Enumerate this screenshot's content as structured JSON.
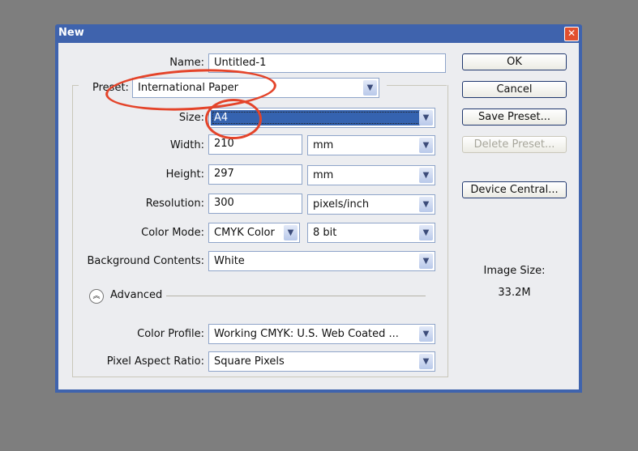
{
  "window": {
    "title": "New",
    "close_icon": "close-icon"
  },
  "fields": {
    "name": {
      "label": "Name:",
      "value": "Untitled-1"
    },
    "preset": {
      "label": "Preset:",
      "value": "International Paper"
    },
    "size": {
      "label": "Size:",
      "value": "A4"
    },
    "width": {
      "label": "Width:",
      "value": "210",
      "unit": "mm"
    },
    "height": {
      "label": "Height:",
      "value": "297",
      "unit": "mm"
    },
    "resolution": {
      "label": "Resolution:",
      "value": "300",
      "unit": "pixels/inch"
    },
    "color_mode": {
      "label": "Color Mode:",
      "value": "CMYK Color",
      "depth": "8 bit"
    },
    "background": {
      "label": "Background Contents:",
      "value": "White"
    },
    "advanced": {
      "label": "Advanced"
    },
    "color_profile": {
      "label": "Color Profile:",
      "value": "Working CMYK:  U.S. Web Coated ..."
    },
    "pixel_aspect": {
      "label": "Pixel Aspect Ratio:",
      "value": "Square Pixels"
    }
  },
  "buttons": {
    "ok": "OK",
    "cancel": "Cancel",
    "save_preset": "Save Preset...",
    "delete_preset": "Delete Preset...",
    "device_central": "Device Central..."
  },
  "image_size": {
    "label": "Image Size:",
    "value": "33.2M"
  },
  "colors": {
    "annotation": "#e4442a",
    "titlebar": "#3f63ad"
  }
}
